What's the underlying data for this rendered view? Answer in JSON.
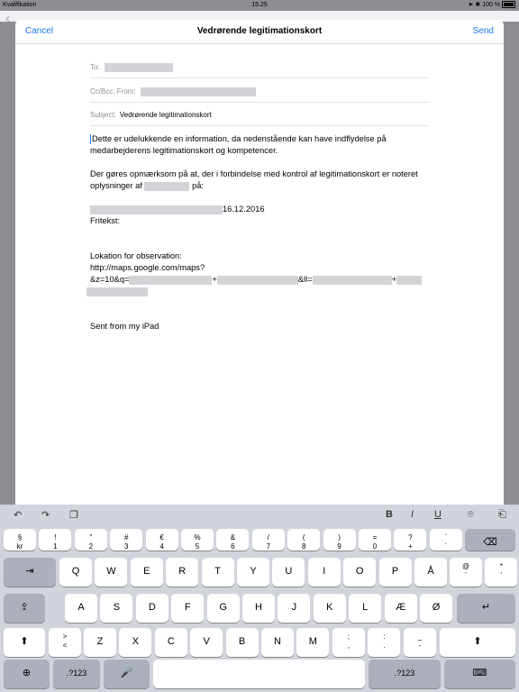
{
  "status": {
    "carrier": "Kvalifikation",
    "time": "15.25",
    "battery": "100 %"
  },
  "nav": {
    "cancel": "Cancel",
    "title": "Vedrørende legitimationskort",
    "send": "Send"
  },
  "fields": {
    "to_label": "To:",
    "cc_label": "Cc/Bcc, From:",
    "subject_label": "Subject:",
    "subject_value": "Vedrørende legitimationskort"
  },
  "body": {
    "p1": "Dette er udelukkende en information, da nedenstående kan have indflydelse på medarbejderens legitimationskort og kompetencer.",
    "p2a": "Der gøres opmærksom på at, der i forbindelse med kontrol af legitimationskort er noteret oplysninger af",
    "p2b": "på:",
    "date": "16.12.2016",
    "fritekst": "Fritekst:",
    "loc_label": "Lokation for observation:",
    "url1": "http://maps.google.com/maps?",
    "url2": "&z=10&q=",
    "plus": "+",
    "ll": "&ll=",
    "signature": "Sent from my iPad"
  },
  "toolbar": {
    "bold": "B",
    "italic": "I",
    "underline": "U"
  },
  "keyboard": {
    "numrow": [
      {
        "t": "§",
        "b": "kr"
      },
      {
        "t": "!",
        "b": "1"
      },
      {
        "t": "\"",
        "b": "2"
      },
      {
        "t": "#",
        "b": "3"
      },
      {
        "t": "€",
        "b": "4"
      },
      {
        "t": "%",
        "b": "5"
      },
      {
        "t": "&",
        "b": "6"
      },
      {
        "t": "/",
        "b": "7"
      },
      {
        "t": "(",
        "b": "8"
      },
      {
        "t": ")",
        "b": "9"
      },
      {
        "t": "=",
        "b": "0"
      },
      {
        "t": "?",
        "b": "+"
      },
      {
        "t": "`",
        "b": "´"
      }
    ],
    "row1": [
      "Q",
      "W",
      "E",
      "R",
      "T",
      "Y",
      "U",
      "I",
      "O",
      "P",
      "Å"
    ],
    "row1_extra": [
      {
        "t": "@",
        "b": "¨"
      },
      {
        "t": "*",
        "b": "'"
      }
    ],
    "row2": [
      "A",
      "S",
      "D",
      "F",
      "G",
      "H",
      "J",
      "K",
      "L",
      "Æ",
      "Ø"
    ],
    "row3_first": {
      "t": ">",
      "b": "<"
    },
    "row3": [
      "Z",
      "X",
      "C",
      "V",
      "B",
      "N",
      "M"
    ],
    "row3_punct": [
      {
        "t": ";",
        "b": ","
      },
      {
        "t": ":",
        "b": "."
      },
      {
        "t": "_",
        "b": "-"
      }
    ],
    "mode_label": ".?123"
  }
}
